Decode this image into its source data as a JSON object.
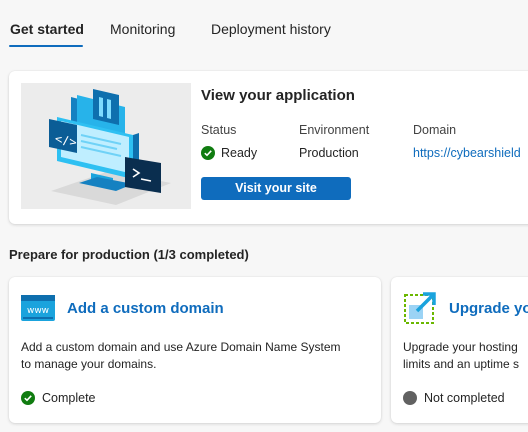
{
  "tabs": [
    {
      "label": "Get started",
      "active": true
    },
    {
      "label": "Monitoring",
      "active": false
    },
    {
      "label": "Deployment history",
      "active": false
    }
  ],
  "app_card": {
    "title": "View your application",
    "status_label": "Status",
    "status_value": "Ready",
    "environment_label": "Environment",
    "environment_value": "Production",
    "domain_label": "Domain",
    "domain_value": "https://cybearshield",
    "visit_button": "Visit your site",
    "illustration_icon": "web-app-illustration"
  },
  "section": {
    "heading": "Prepare for production (1/3 completed)"
  },
  "tasks": [
    {
      "title": "Add a custom domain",
      "icon": "www-icon",
      "description_line1": "Add a custom domain and use Azure Domain Name System",
      "description_line2": "to manage your domains.",
      "status": "Complete",
      "status_icon": "check-circle-icon"
    },
    {
      "title": "Upgrade yo",
      "icon": "upgrade-arrow-icon",
      "description_line1": "Upgrade your hosting",
      "description_line2": "limits and an uptime s",
      "status": "Not completed",
      "status_icon": "grey-dot-icon"
    }
  ],
  "colors": {
    "accent": "#0f6cbd",
    "success": "#107c10",
    "neutral": "#616161",
    "background": "#f7f7f7",
    "card": "#ffffff"
  }
}
